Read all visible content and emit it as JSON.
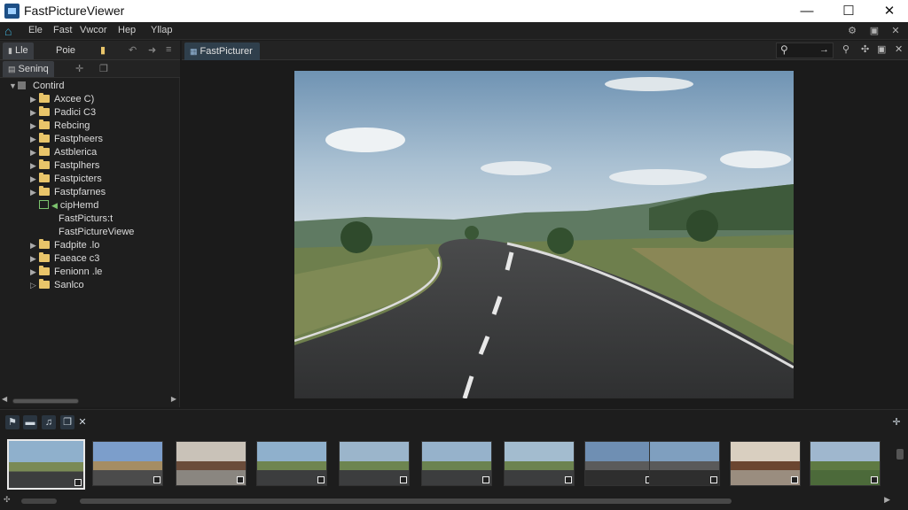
{
  "app": {
    "title": "FastPictureViewer"
  },
  "window_controls": {
    "minimize": "—",
    "maximize": "☐",
    "close": "✕"
  },
  "menu": {
    "items": [
      "Ele",
      "Fast",
      "Vwcor",
      "Hep",
      "Yllap"
    ]
  },
  "left_panel": {
    "tabs": [
      "Lle",
      "Poie"
    ],
    "subtab": "Seninq",
    "tree": {
      "root": "Contird",
      "items": [
        {
          "label": "Axcee C)",
          "type": "folder"
        },
        {
          "label": "Padici C3",
          "type": "folder"
        },
        {
          "label": "Rebcing",
          "type": "folder"
        },
        {
          "label": "Fastpheers",
          "type": "folder"
        },
        {
          "label": "Astblerica",
          "type": "folder"
        },
        {
          "label": "Fastplhers",
          "type": "folder"
        },
        {
          "label": "Fastpicters",
          "type": "folder"
        },
        {
          "label": "Fastpfarnes",
          "type": "folder"
        },
        {
          "label": "cipHemd",
          "type": "special"
        },
        {
          "label": "FastPicturs:t",
          "type": "plain"
        },
        {
          "label": "FastPictureViewe",
          "type": "plain"
        },
        {
          "label": "Fadpite .lo",
          "type": "folder"
        },
        {
          "label": "Faeace c3",
          "type": "folder"
        },
        {
          "label": "Fenionn .le",
          "type": "folder"
        },
        {
          "label": "Sanlco",
          "type": "folder"
        }
      ]
    }
  },
  "viewer": {
    "tab_label": "FastPicturer"
  },
  "thumbnails": {
    "count": 11,
    "selected_index": 0
  },
  "colors": {
    "accent": "#3fb0d9",
    "folder": "#e9c56a",
    "background": "#1b1b1b",
    "tab_active": "#2f3f4c"
  },
  "icons": {
    "home": "home-icon",
    "search": "search-icon",
    "folder": "folder-icon",
    "close": "close-icon"
  }
}
